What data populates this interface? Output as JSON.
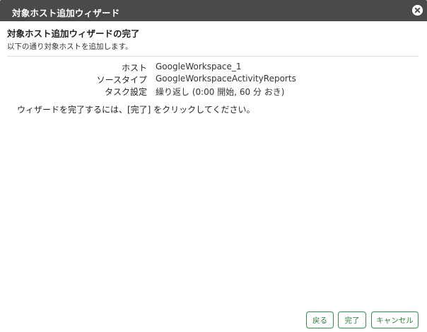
{
  "window": {
    "title": "対象ホスト追加ウィザード"
  },
  "content": {
    "heading": "対象ホスト追加ウィザードの完了",
    "subtext": "以下の通り対象ホストを追加します。",
    "summary": [
      {
        "label": "ホスト",
        "value": "GoogleWorkspace_1"
      },
      {
        "label": "ソースタイプ",
        "value": "GoogleWorkspaceActivityReports"
      },
      {
        "label": "タスク設定",
        "value": "繰り返し (0:00 開始, 60 分 おき)"
      }
    ],
    "finish_note": "ウィザードを完了するには、[完了] をクリックしてください。"
  },
  "footer": {
    "back_label": "戻る",
    "finish_label": "完了",
    "cancel_label": "キャンセル"
  },
  "colors": {
    "titlebar": "#4a4a4a",
    "button_border": "#3c8a4a",
    "button_text": "#2e7d3a"
  },
  "icons": {
    "close": "close-circle-icon"
  }
}
